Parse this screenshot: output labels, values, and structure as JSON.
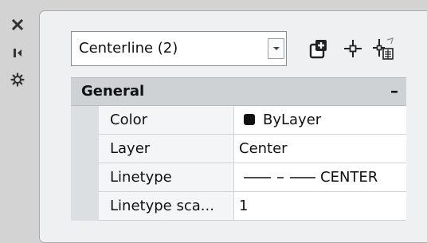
{
  "palette_strip": {
    "items": [
      {
        "name": "close",
        "icon": "close-icon"
      },
      {
        "name": "auto-hide",
        "icon": "auto-hide-icon"
      },
      {
        "name": "properties",
        "icon": "settings-icon"
      }
    ]
  },
  "selection_dropdown": {
    "value": "Centerline (2)"
  },
  "toolbar": {
    "icons": [
      "toggle-pickadd-icon",
      "select-objects-icon",
      "quick-select-icon"
    ]
  },
  "section": {
    "title": "General",
    "collapse_symbol": "–"
  },
  "properties": [
    {
      "label": "Color",
      "value": "ByLayer",
      "swatch_color": "#111111"
    },
    {
      "label": "Layer",
      "value": "Center"
    },
    {
      "label": "Linetype",
      "value": "CENTER"
    },
    {
      "label": "Linetype sca...",
      "value": "1"
    }
  ],
  "colors": {
    "panel_bg": "#eef0f1",
    "strip_bg": "#d3d3d3",
    "header_bg": "#cfd2d4"
  }
}
